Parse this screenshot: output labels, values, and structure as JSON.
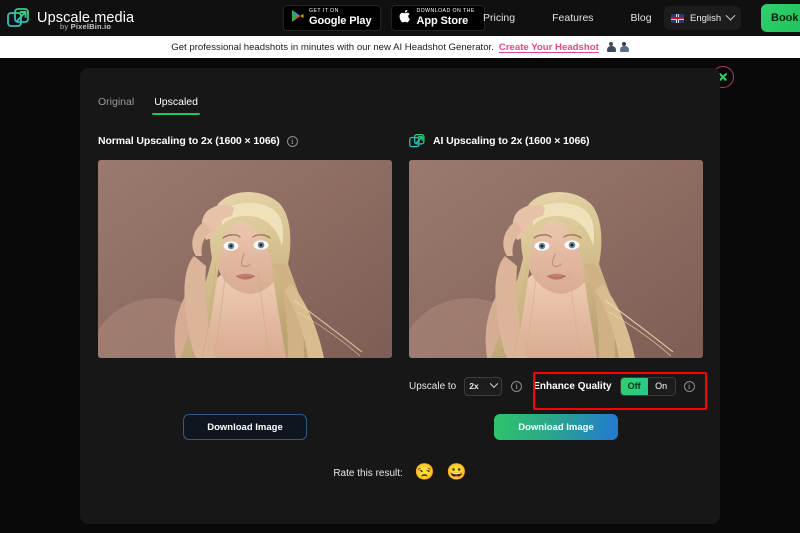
{
  "header": {
    "brand": {
      "name": "Upscale.media",
      "by": "by",
      "sub": "PixelBin.io",
      "logo_icon": "upscale-logo-icon"
    },
    "store_badges": [
      {
        "icon": "google-play-icon",
        "top": "GET IT ON",
        "bottom": "Google Play"
      },
      {
        "icon": "apple-icon",
        "top": "Download on the",
        "bottom": "App Store"
      }
    ],
    "nav": [
      {
        "label": "Pricing"
      },
      {
        "label": "Features"
      },
      {
        "label": "Blog"
      }
    ],
    "language": {
      "label": "English",
      "flag_icon": "uk-flag-icon",
      "chevron_icon": "chevron-down-icon"
    },
    "cta": {
      "label": "Book a"
    }
  },
  "promo": {
    "text": "Get professional headshots in minutes with our new AI Headshot Generator.",
    "link": "Create Your Headshot",
    "icons": [
      "person-icon",
      "person-icon"
    ]
  },
  "panel": {
    "close_icon": "close-icon",
    "tabs": [
      {
        "label": "Original",
        "active": false
      },
      {
        "label": "Upscaled",
        "active": true
      }
    ],
    "left": {
      "title": "Normal Upscaling to 2x (1600 × 1066)",
      "info_icon": "info-icon",
      "image_alt": "upscaled-portrait-preview",
      "download_label": "Download Image"
    },
    "right": {
      "title": "AI Upscaling to 2x (1600 × 1066)",
      "title_icon": "upscale-logo-icon",
      "image_alt": "ai-upscaled-portrait-preview",
      "upscale_to_label": "Upscale to",
      "upscale_to_value": "2x",
      "upscale_info_icon": "info-icon",
      "enhance_label": "Enhance Quality",
      "enhance_options": [
        {
          "label": "Off",
          "selected": true
        },
        {
          "label": "On",
          "selected": false
        }
      ],
      "enhance_info_icon": "info-icon",
      "download_label": "Download Image"
    },
    "rate": {
      "label": "Rate this result:",
      "emojis": [
        {
          "name": "sad-face-emoji",
          "glyph": "😒"
        },
        {
          "name": "happy-face-emoji",
          "glyph": "😀"
        }
      ]
    }
  },
  "colors": {
    "accent_green": "#22c55e",
    "accent_blue": "#2378d4",
    "promo_link": "#e8468a",
    "annotation_red": "#ff0000",
    "panel_bg": "#171717",
    "page_bg": "#090909"
  }
}
